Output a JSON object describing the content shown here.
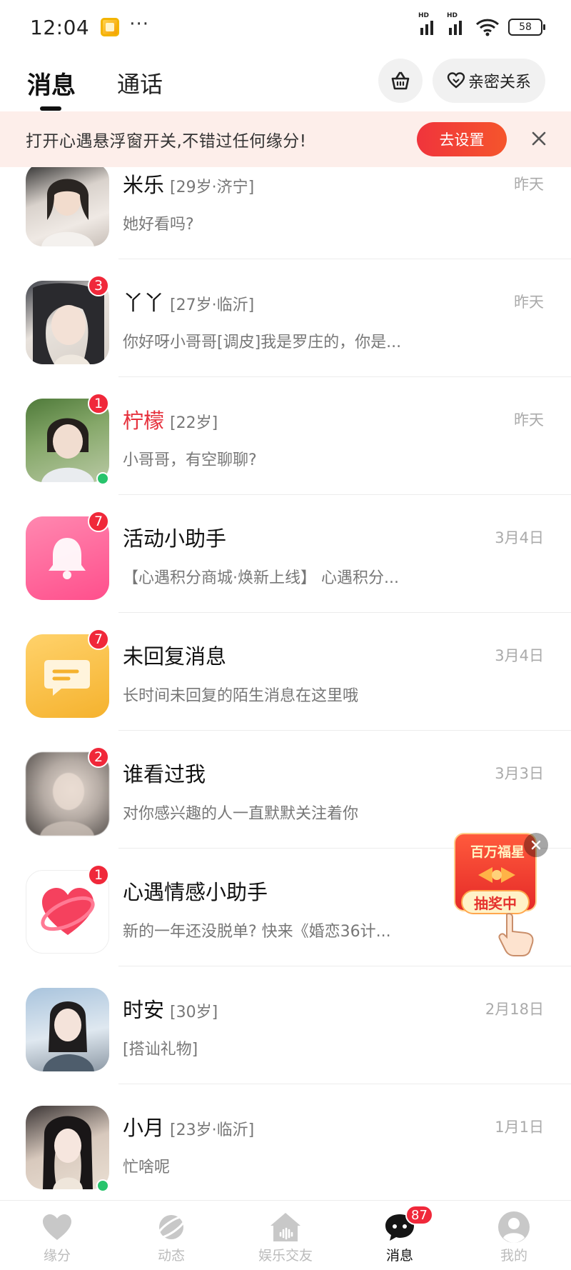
{
  "status_bar": {
    "time": "12:04",
    "dots": "···",
    "signal_label": "HD",
    "battery": "58"
  },
  "header": {
    "tabs": [
      {
        "label": "消息",
        "active": true
      },
      {
        "label": "通话",
        "active": false
      }
    ],
    "basket_icon": "basket-icon",
    "intimacy_label": "亲密关系"
  },
  "notice": {
    "text": "打开心遇悬浮窗开关,不错过任何缘分!",
    "button": "去设置"
  },
  "conversations": [
    {
      "name": "米乐",
      "meta": "[29岁·济宁]",
      "time": "昨天",
      "preview": "她好看吗?",
      "badge": "",
      "online": false,
      "name_red": false
    },
    {
      "name": "丫丫",
      "meta": "[27岁·临沂]",
      "time": "昨天",
      "preview": "你好呀小哥哥[调皮]我是罗庄的，你是...",
      "badge": "3",
      "online": false,
      "name_red": false
    },
    {
      "name": "柠檬",
      "meta": "[22岁]",
      "time": "昨天",
      "preview": "小哥哥，有空聊聊?",
      "badge": "1",
      "online": true,
      "name_red": true
    },
    {
      "name": "活动小助手",
      "meta": "",
      "time": "3月4日",
      "preview": "【心遇积分商城·焕新上线】 心遇积分...",
      "badge": "7",
      "online": false,
      "name_red": false
    },
    {
      "name": "未回复消息",
      "meta": "",
      "time": "3月4日",
      "preview": "长时间未回复的陌生消息在这里哦",
      "badge": "7",
      "online": false,
      "name_red": false
    },
    {
      "name": "谁看过我",
      "meta": "",
      "time": "3月3日",
      "preview": "对你感兴趣的人一直默默关注着你",
      "badge": "2",
      "online": false,
      "name_red": false
    },
    {
      "name": "心遇情感小助手",
      "meta": "",
      "time": "",
      "preview": "新的一年还没脱单? 快来《婚恋36计...",
      "badge": "1",
      "online": false,
      "name_red": false
    },
    {
      "name": "时安",
      "meta": "[30岁]",
      "time": "2月18日",
      "preview": "[搭讪礼物]",
      "badge": "",
      "online": false,
      "name_red": false
    },
    {
      "name": "小月",
      "meta": "[23岁·临沂]",
      "time": "1月1日",
      "preview": "忙啥呢",
      "badge": "",
      "online": true,
      "name_red": false
    }
  ],
  "lottery": {
    "title": "百万福星",
    "pill": "抽奖中"
  },
  "bottom_nav": [
    {
      "label": "缘分",
      "icon": "heart-icon",
      "active": false
    },
    {
      "label": "动态",
      "icon": "planet-icon",
      "active": false
    },
    {
      "label": "娱乐交友",
      "icon": "house-voice-icon",
      "active": false
    },
    {
      "label": "消息",
      "icon": "chat-bubble-icon",
      "active": true,
      "badge": "87"
    },
    {
      "label": "我的",
      "icon": "profile-icon",
      "active": false
    }
  ],
  "colors": {
    "accent_red": "#f0283a",
    "online_green": "#27c46c",
    "notice_bg": "#fdeeea"
  }
}
